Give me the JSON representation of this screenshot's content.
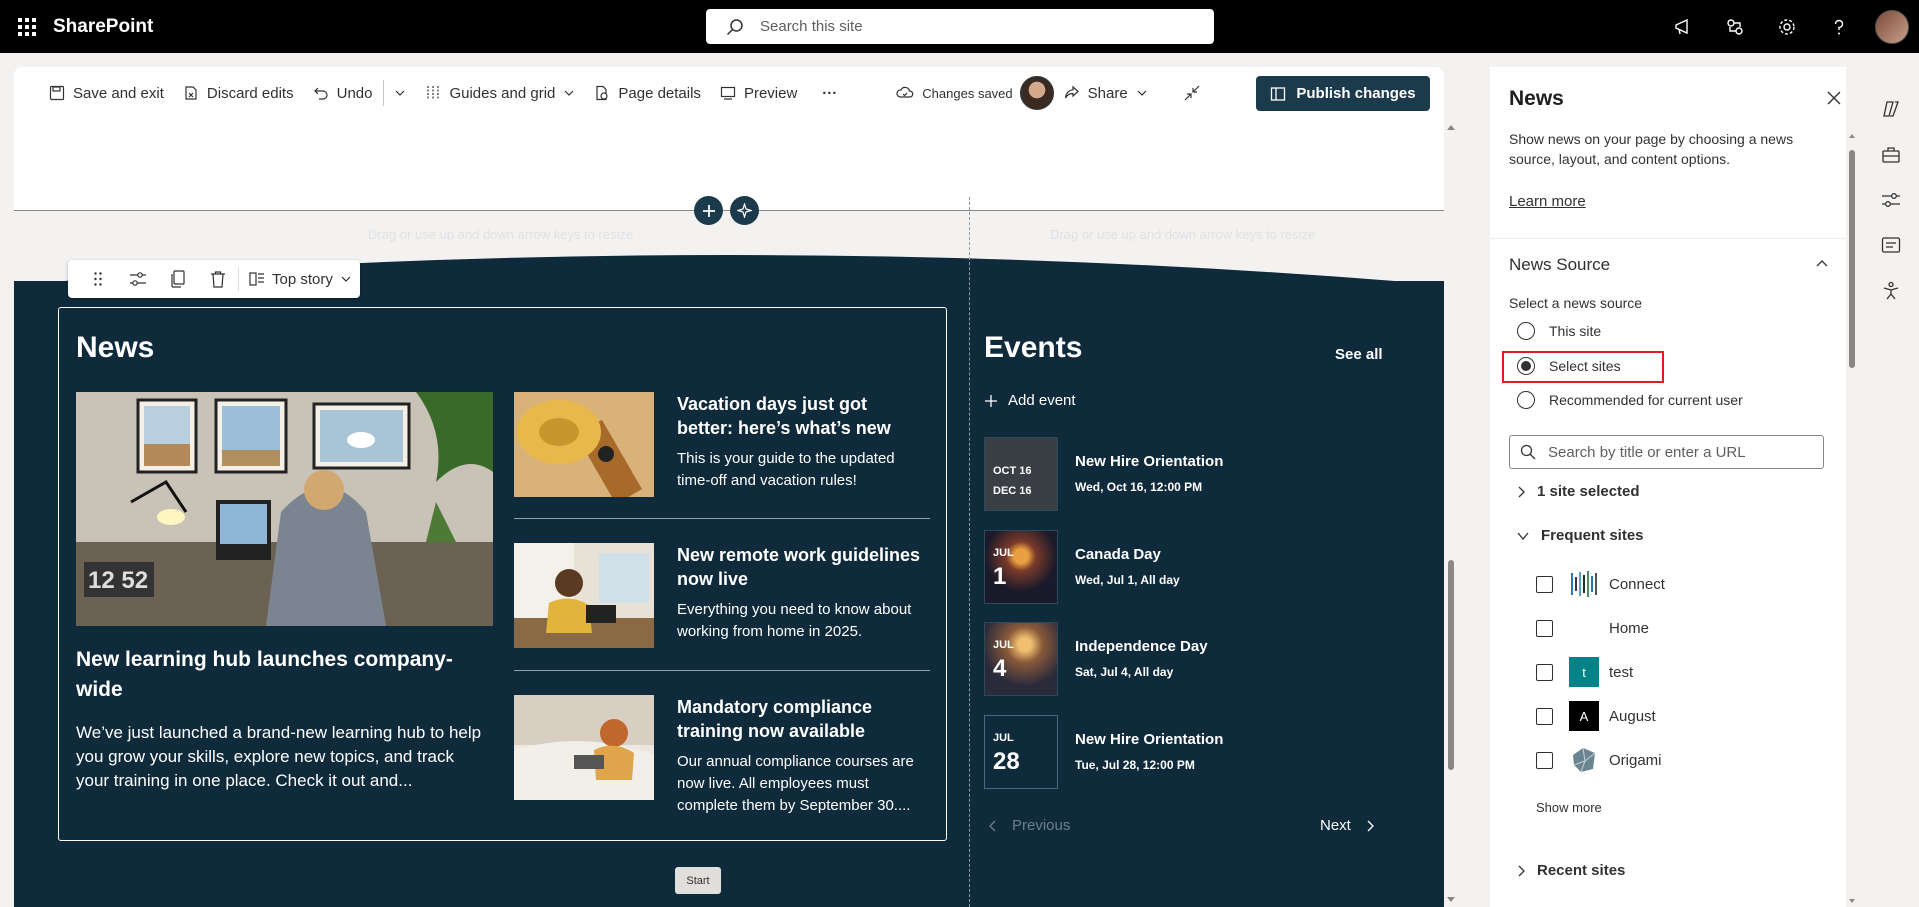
{
  "suite": {
    "app_name": "SharePoint",
    "search_placeholder": "Search this site",
    "icons": [
      "megaphone-icon",
      "connections-icon",
      "settings-icon",
      "help-icon",
      "account-avatar"
    ]
  },
  "command_bar": {
    "save_exit": "Save and exit",
    "discard": "Discard edits",
    "undo": "Undo",
    "guides": "Guides and grid",
    "page_details": "Page details",
    "preview": "Preview",
    "more": "···",
    "status": "Changes saved",
    "share": "Share",
    "publish": "Publish changes"
  },
  "canvas": {
    "drag_hint_left": "Drag or use up and down arrow keys to resize",
    "drag_hint_right": "Drag or use up and down arrow keys to resize",
    "layout_label": "Top story",
    "start_label": "Start"
  },
  "news": {
    "title": "News",
    "hero": {
      "title": "New learning hub launches company-wide",
      "description": "We’ve just launched a brand-new learning hub to help you grow your skills, explore new topics, and track your training in one place. Check it out and..."
    },
    "items": [
      {
        "title": "Vacation days just got better: here’s what’s new",
        "description": "This is your guide to the updated time-off and vacation rules!"
      },
      {
        "title": "New remote work guidelines now live",
        "description": "Everything you need to know about working from home in 2025."
      },
      {
        "title": "Mandatory compliance training now available",
        "description": "Our annual compliance courses are now live. All employees must complete them by September 30...."
      }
    ]
  },
  "events": {
    "title": "Events",
    "see_all": "See all",
    "add_event": "Add event",
    "items": [
      {
        "month1": "OCT 16",
        "month2": "DEC 16",
        "day": "",
        "name": "New Hire Orientation",
        "when": "Wed, Oct 16, 12:00 PM"
      },
      {
        "month1": "JUL",
        "month2": "",
        "day": "1",
        "name": "Canada Day",
        "when": "Wed, Jul 1, All day"
      },
      {
        "month1": "JUL",
        "month2": "",
        "day": "4",
        "name": "Independence Day",
        "when": "Sat, Jul 4, All day"
      },
      {
        "month1": "JUL",
        "month2": "",
        "day": "28",
        "name": "New Hire Orientation",
        "when": "Tue, Jul 28, 12:00 PM"
      }
    ],
    "previous": "Previous",
    "next": "Next"
  },
  "pane": {
    "title": "News",
    "description": "Show news on your page by choosing a news source, layout, and content options.",
    "learn_more": "Learn more",
    "source_title": "News Source",
    "select_label": "Select a news source",
    "options": [
      "This site",
      "Select sites",
      "Recommended for current user"
    ],
    "selected_option": "Select sites",
    "search_placeholder": "Search by title or enter a URL",
    "selected_count": "1 site selected",
    "frequent_label": "Frequent sites",
    "sites": [
      {
        "name": "Connect",
        "logo": ""
      },
      {
        "name": "Home",
        "logo": ""
      },
      {
        "name": "test",
        "logo": "t"
      },
      {
        "name": "August",
        "logo": "A"
      },
      {
        "name": "Origami",
        "logo": ""
      }
    ],
    "show_more": "Show more",
    "recent_label": "Recent sites"
  },
  "colors": {
    "brand_dark": "#1b3a4b",
    "section_bg": "#0e2a3b",
    "highlight": "#e21d1d",
    "test_logo": "#038387"
  }
}
